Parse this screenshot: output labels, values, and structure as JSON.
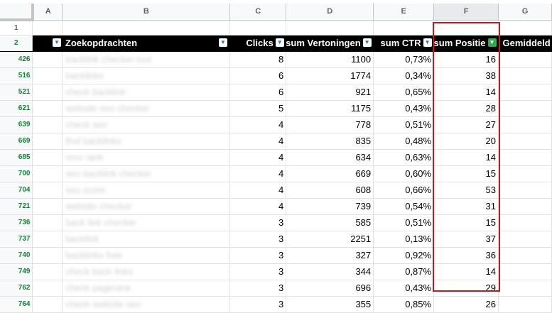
{
  "columns": [
    "A",
    "B",
    "C",
    "D",
    "E",
    "F",
    "G"
  ],
  "selected_column": "F",
  "row1_label": "1",
  "header_row": {
    "row_label": "2",
    "zoekopdrachten": "Zoekopdrachten",
    "clicks": "Clicks",
    "vertoningen": "sum Vertoningen",
    "ctr": "sum CTR",
    "positie": "sum Positie",
    "gemiddeld": "Gemiddeld"
  },
  "rows": [
    {
      "row": "426",
      "query": "backlink checker tool",
      "clicks": "8",
      "impressions": "1100",
      "ctr": "0,73%",
      "position": "16"
    },
    {
      "row": "516",
      "query": "backlinks",
      "clicks": "6",
      "impressions": "1774",
      "ctr": "0,34%",
      "position": "38"
    },
    {
      "row": "521",
      "query": "check backlink",
      "clicks": "6",
      "impressions": "921",
      "ctr": "0,65%",
      "position": "14"
    },
    {
      "row": "621",
      "query": "website seo checker",
      "clicks": "5",
      "impressions": "1175",
      "ctr": "0,43%",
      "position": "28"
    },
    {
      "row": "639",
      "query": "check seo",
      "clicks": "4",
      "impressions": "778",
      "ctr": "0,51%",
      "position": "27"
    },
    {
      "row": "669",
      "query": "find backlinks",
      "clicks": "4",
      "impressions": "835",
      "ctr": "0,48%",
      "position": "20"
    },
    {
      "row": "685",
      "query": "moz rank",
      "clicks": "4",
      "impressions": "634",
      "ctr": "0,63%",
      "position": "14"
    },
    {
      "row": "700",
      "query": "seo backlink checker",
      "clicks": "4",
      "impressions": "669",
      "ctr": "0,60%",
      "position": "15"
    },
    {
      "row": "704",
      "query": "seo score",
      "clicks": "4",
      "impressions": "608",
      "ctr": "0,66%",
      "position": "53"
    },
    {
      "row": "721",
      "query": "website checker",
      "clicks": "4",
      "impressions": "739",
      "ctr": "0,54%",
      "position": "31"
    },
    {
      "row": "736",
      "query": "back link checker",
      "clicks": "3",
      "impressions": "585",
      "ctr": "0,51%",
      "position": "15"
    },
    {
      "row": "737",
      "query": "backlink",
      "clicks": "3",
      "impressions": "2251",
      "ctr": "0,13%",
      "position": "37"
    },
    {
      "row": "740",
      "query": "backlinks free",
      "clicks": "3",
      "impressions": "327",
      "ctr": "0,92%",
      "position": "36"
    },
    {
      "row": "749",
      "query": "check back links",
      "clicks": "3",
      "impressions": "344",
      "ctr": "0,87%",
      "position": "14"
    },
    {
      "row": "762",
      "query": "check pagerank",
      "clicks": "3",
      "impressions": "696",
      "ctr": "0,43%",
      "position": "29"
    },
    {
      "row": "764",
      "query": "check website seo",
      "clicks": "3",
      "impressions": "355",
      "ctr": "0,85%",
      "position": "26"
    }
  ],
  "colors": {
    "header_bg": "#000000",
    "filtered_row_number": "#188038",
    "highlight_border": "#d2131e",
    "active_filter": "#34a853"
  }
}
